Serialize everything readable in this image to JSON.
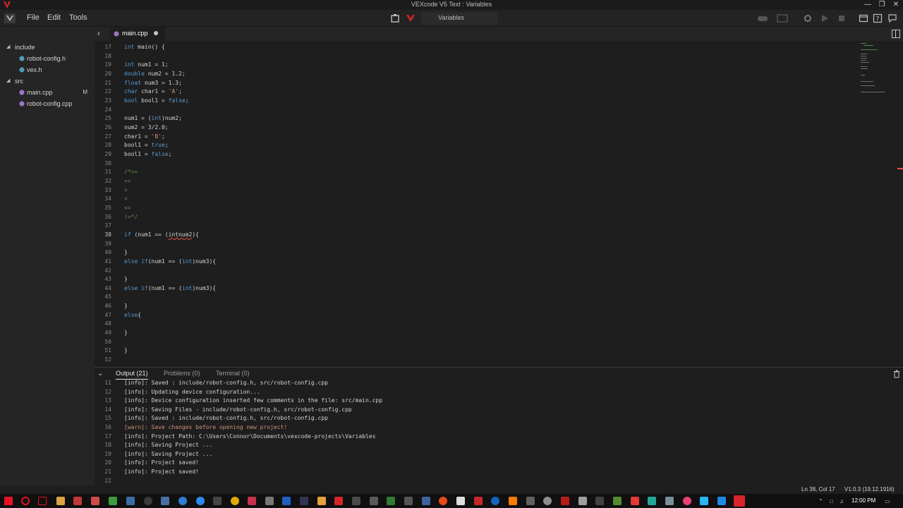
{
  "window": {
    "title": "VEXcode V5 Text : Variables"
  },
  "menu": {
    "file": "File",
    "edit": "Edit",
    "tools": "Tools",
    "project_name": "Variables"
  },
  "sidebar": {
    "items": [
      {
        "label": "include",
        "type": "folder"
      },
      {
        "label": "robot-config.h",
        "type": "file"
      },
      {
        "label": "vex.h",
        "type": "file"
      },
      {
        "label": "src",
        "type": "folder"
      },
      {
        "label": "main.cpp",
        "type": "file",
        "badge": "M"
      },
      {
        "label": "robot-config.cpp",
        "type": "file"
      }
    ]
  },
  "editor": {
    "tab_label": "main.cpp",
    "lines": [
      {
        "n": "17",
        "html": "<span class=\"kw\">int</span> main() {"
      },
      {
        "n": "18",
        "html": ""
      },
      {
        "n": "19",
        "html": "<span class=\"kw\">int</span> num1 = 1;"
      },
      {
        "n": "20",
        "html": "<span class=\"kw\">double</span> num2 = 1.2;"
      },
      {
        "n": "21",
        "html": "<span class=\"kw\">float</span> num3 = 1.3;"
      },
      {
        "n": "22",
        "html": "<span class=\"kw\">char</span> char1 = <span class=\"str\">'A'</span>;"
      },
      {
        "n": "23",
        "html": "<span class=\"kw\">bool</span> bool1 = <span class=\"kw\">false</span>;"
      },
      {
        "n": "24",
        "html": ""
      },
      {
        "n": "25",
        "html": "num1 = (<span class=\"kw\">int</span>)num2;"
      },
      {
        "n": "26",
        "html": "num2 = 3/2.0;"
      },
      {
        "n": "27",
        "html": "char1 = <span class=\"str\">'B'</span>;"
      },
      {
        "n": "28",
        "html": "bool1 = <span class=\"kw\">true</span>;"
      },
      {
        "n": "29",
        "html": "bool1 = <span class=\"kw\">false</span>;"
      },
      {
        "n": "30",
        "html": ""
      },
      {
        "n": "31",
        "html": "<span class=\"cm\">/*==</span>"
      },
      {
        "n": "32",
        "html": "<span class=\"cm\">>=</span>"
      },
      {
        "n": "33",
        "html": "<span class=\"cm\">></span>"
      },
      {
        "n": "34",
        "html": "<span class=\"cm\"><</span>"
      },
      {
        "n": "35",
        "html": "<span class=\"cm\"><=</span>"
      },
      {
        "n": "36",
        "html": "<span class=\"cm\">!=*/</span>"
      },
      {
        "n": "37",
        "html": ""
      },
      {
        "n": "38",
        "html": "<span class=\"kw\">if</span> (num1 == (<span class=\"err\">intnum2</span>){",
        "active": true
      },
      {
        "n": "39",
        "html": ""
      },
      {
        "n": "40",
        "html": "}"
      },
      {
        "n": "41",
        "html": "<span class=\"kw\">else</span> <span class=\"kw\">if</span>(num1 == (<span class=\"kw\">int</span>)num3){"
      },
      {
        "n": "42",
        "html": ""
      },
      {
        "n": "43",
        "html": "}"
      },
      {
        "n": "44",
        "html": "<span class=\"kw\">else</span> <span class=\"kw\">if</span>(num1 == (<span class=\"kw\">int</span>)num3){"
      },
      {
        "n": "45",
        "html": ""
      },
      {
        "n": "46",
        "html": "}"
      },
      {
        "n": "47",
        "html": "<span class=\"kw\">else</span>{"
      },
      {
        "n": "48",
        "html": ""
      },
      {
        "n": "49",
        "html": "}"
      },
      {
        "n": "50",
        "html": ""
      },
      {
        "n": "51",
        "html": "}"
      },
      {
        "n": "52",
        "html": ""
      }
    ]
  },
  "panel": {
    "tabs": {
      "output": "Output (21)",
      "problems": "Problems (0)",
      "terminal": "Terminal (0)"
    },
    "lines": [
      {
        "n": "11",
        "text": "[info]: Saved : include/robot-config.h, src/robot-config.cpp"
      },
      {
        "n": "12",
        "text": "[info]: Updating device configuration..."
      },
      {
        "n": "13",
        "text": "[info]: Device configuration inserted few comments in the file: src/main.cpp"
      },
      {
        "n": "14",
        "text": "[info]: Saving Files - include/robot-config.h, src/robot-config.cpp"
      },
      {
        "n": "15",
        "text": "[info]: Saved : include/robot-config.h, src/robot-config.cpp"
      },
      {
        "n": "16",
        "text": "[warn]: Save changes before opening new project!",
        "warn": true
      },
      {
        "n": "17",
        "text": "[info]: Project Path: C:\\Users\\Connor\\Documents\\vexcode-projects\\Variables"
      },
      {
        "n": "18",
        "text": "[info]: Saving Project ..."
      },
      {
        "n": "19",
        "text": "[info]: Saving Project ..."
      },
      {
        "n": "20",
        "text": "[info]: Project saved!"
      },
      {
        "n": "21",
        "text": "[info]: Project saved!"
      },
      {
        "n": "22",
        "text": ""
      }
    ]
  },
  "status": {
    "position": "Ln 38, Col 17",
    "version": "V1.0.3 (19.12.1916)"
  },
  "taskbar": {
    "time": "12:00 PM"
  },
  "colors": {
    "vex_red": "#d7242a",
    "keyword": "#569cd6",
    "string": "#ce9178",
    "comment": "#608b4e",
    "warn": "#ce9178"
  }
}
